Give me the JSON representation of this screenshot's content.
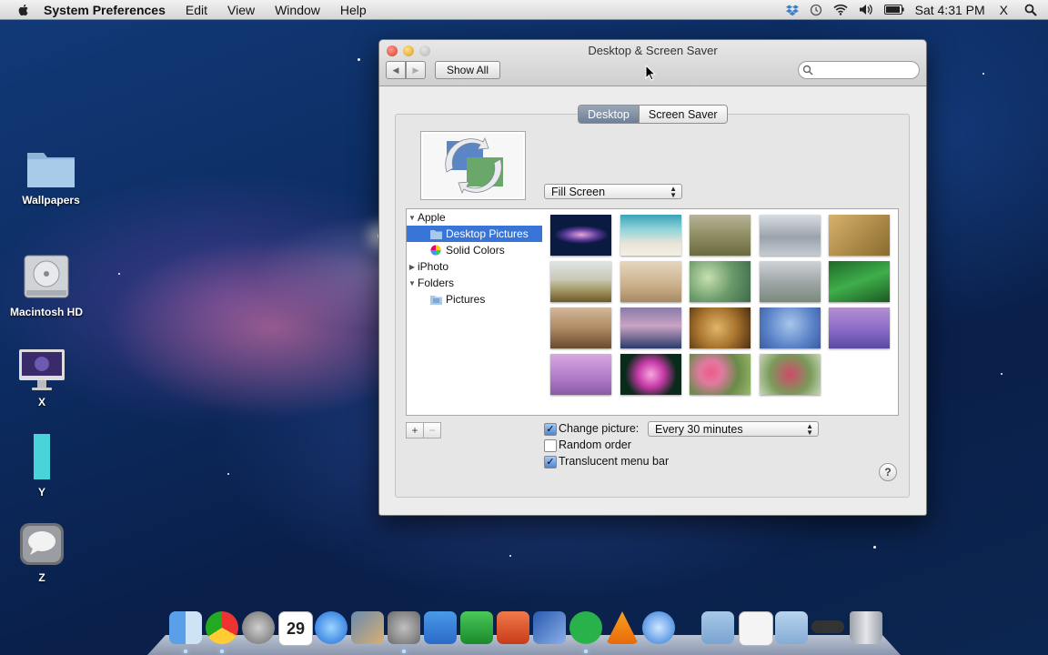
{
  "menubar": {
    "app_name": "System Preferences",
    "items": [
      "Edit",
      "View",
      "Window",
      "Help"
    ],
    "clock": "Sat 4:31 PM",
    "user": "X"
  },
  "desktop_icons": [
    {
      "label": "Wallpapers",
      "icon": "folder-icon"
    },
    {
      "label": "Macintosh HD",
      "icon": "hard-drive-icon"
    },
    {
      "label": "X",
      "icon": "imac-icon"
    },
    {
      "label": "Y",
      "icon": "document-icon"
    },
    {
      "label": "Z",
      "icon": "speech-bubble-icon"
    }
  ],
  "window": {
    "title": "Desktop & Screen Saver",
    "show_all": "Show All",
    "search_placeholder": "",
    "tabs": [
      {
        "label": "Desktop",
        "selected": true
      },
      {
        "label": "Screen Saver",
        "selected": false
      }
    ],
    "fit_option": "Fill Screen",
    "sources": [
      {
        "label": "Apple",
        "level": 0,
        "expanded": true
      },
      {
        "label": "Desktop Pictures",
        "level": 1,
        "selected": true
      },
      {
        "label": "Solid Colors",
        "level": 1
      },
      {
        "label": "iPhoto",
        "level": 0,
        "expanded": false
      },
      {
        "label": "Folders",
        "level": 0,
        "expanded": true
      },
      {
        "label": "Pictures",
        "level": 1
      }
    ],
    "add_label": "+",
    "remove_label": "−",
    "change_picture": {
      "label": "Change picture:",
      "checked": true,
      "interval": "Every 30 minutes"
    },
    "random_order": {
      "label": "Random order",
      "checked": false
    },
    "translucent_menu_bar": {
      "label": "Translucent menu bar",
      "checked": true
    },
    "help_label": "?"
  },
  "colors": {
    "selection": "#3875d7",
    "window_bg": "#ececec"
  },
  "dock_apps": [
    "finder-icon",
    "chrome-icon",
    "launchpad-icon",
    "calendar-icon",
    "itunes-icon",
    "iphoto-icon",
    "system-preferences-icon",
    "word-icon",
    "excel-icon",
    "powerpoint-icon",
    "expression-icon",
    "spotify-icon",
    "vlc-icon",
    "quicktime-icon",
    "folder-icon",
    "document-icon",
    "folder-icon",
    "drive-icon",
    "trash-icon"
  ],
  "dock_calendar_day": "29"
}
